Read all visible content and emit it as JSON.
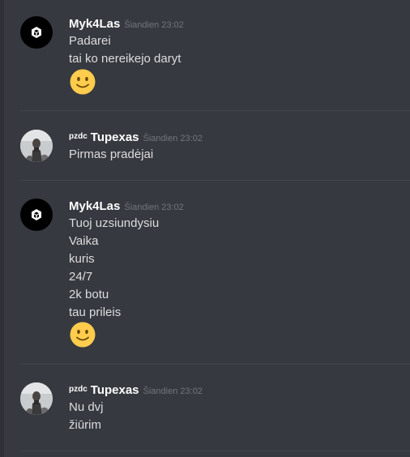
{
  "colors": {
    "background": "#36393f",
    "sidebar_strip": "#2f3136",
    "username": "#ffffff",
    "message_text": "#dcddde",
    "timestamp": "#72767d",
    "divider": "#42454a",
    "emoji_yellow": "#ffcc4d"
  },
  "messages": [
    {
      "author": "Myk4Las",
      "tag": "",
      "timestamp": "Šiandien 23:02",
      "avatar": "cube-logo-icon",
      "lines": [
        "Padarei",
        "tai ko nereikejo daryt"
      ],
      "emoji": "slightly-smiling-face-icon"
    },
    {
      "author": "Tupexas",
      "tag": "pzdc",
      "timestamp": "Šiandien 23:02",
      "avatar": "person-photo-avatar",
      "lines": [
        "Pirmas pradėjai"
      ]
    },
    {
      "author": "Myk4Las",
      "tag": "",
      "timestamp": "Šiandien 23:02",
      "avatar": "cube-logo-icon",
      "lines": [
        "Tuoj uzsiundysiu",
        "Vaika",
        "kuris",
        "24/7",
        "2k botu",
        "tau prileis"
      ],
      "emoji": "slightly-smiling-face-icon"
    },
    {
      "author": "Tupexas",
      "tag": "pzdc",
      "timestamp": "Šiandien 23:02",
      "avatar": "person-photo-avatar",
      "lines": [
        "Nu dvj",
        "žiūrim"
      ]
    }
  ]
}
